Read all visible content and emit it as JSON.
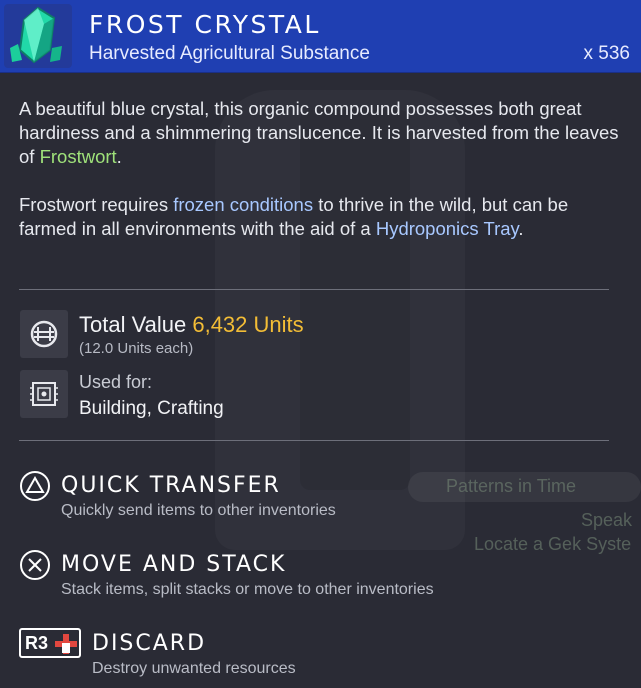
{
  "item": {
    "name": "FROST CRYSTAL",
    "category": "Harvested Agricultural Substance",
    "quantity": "x 536"
  },
  "description": {
    "p1_a": "A beautiful blue crystal, this organic compound possesses both great hardiness and a shimmering translucence. It is harvested from the leaves of ",
    "p1_link": "Frostwort",
    "p1_end": ".",
    "p2_a": "Frostwort requires ",
    "p2_link1": "frozen conditions",
    "p2_b": " to thrive in the wild, but can be farmed in all environments with the aid of a ",
    "p2_link2": "Hydroponics Tray",
    "p2_end": "."
  },
  "value": {
    "label": "Total Value",
    "amount": "6,432 Units",
    "each": "(12.0 Units each)"
  },
  "used_for": {
    "label": "Used for:",
    "value": "Building, Crafting"
  },
  "actions": [
    {
      "title": "QUICK TRANSFER",
      "desc": "Quickly send items to other inventories",
      "icon": "triangle-button-icon"
    },
    {
      "title": "MOVE AND STACK",
      "desc": "Stack items, split stacks or move to other inventories",
      "icon": "cross-button-icon"
    },
    {
      "title": "DISCARD",
      "desc": "Destroy unwanted resources",
      "icon": "r3-button-icon",
      "button_text": "R3"
    }
  ],
  "background_text": {
    "quest1": "Patterns in Time",
    "quest2": "Speak",
    "quest3": "Locate a Gek Syste"
  },
  "colors": {
    "header_bg": "#1f3fb2",
    "highlight_green": "#9fe27a",
    "highlight_blue": "#a8c8ff",
    "value_gold": "#f3bd36"
  }
}
